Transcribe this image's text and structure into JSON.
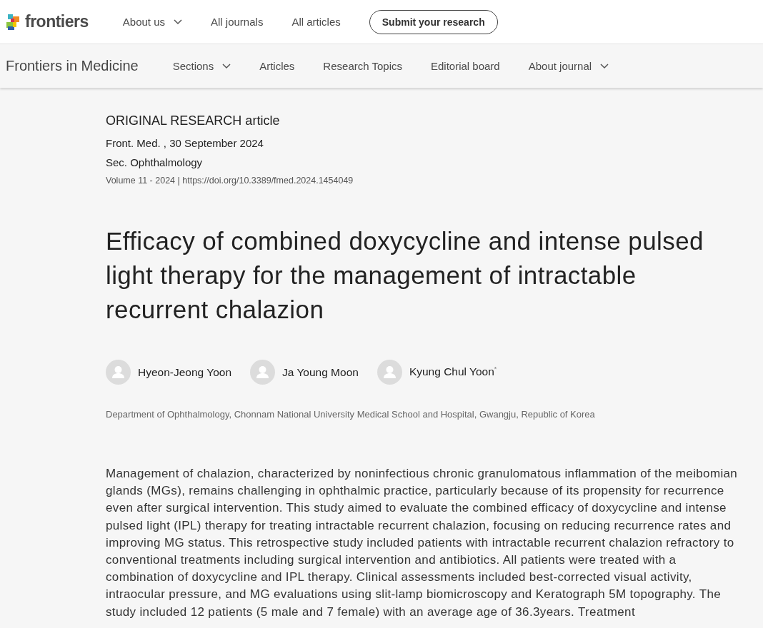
{
  "top_nav": {
    "logo": "frontiers",
    "items": [
      {
        "label": "About us",
        "dropdown": true
      },
      {
        "label": "All journals",
        "dropdown": false
      },
      {
        "label": "All articles",
        "dropdown": false
      }
    ],
    "button": "Submit your research"
  },
  "journal_nav": {
    "title": "Frontiers in Medicine",
    "items": [
      {
        "label": "Sections",
        "dropdown": true
      },
      {
        "label": "Articles",
        "dropdown": false
      },
      {
        "label": "Research Topics",
        "dropdown": false
      },
      {
        "label": "Editorial board",
        "dropdown": false
      },
      {
        "label": "About journal",
        "dropdown": true
      }
    ]
  },
  "article": {
    "type": "ORIGINAL RESEARCH article",
    "date": "Front. Med. , 30 September 2024",
    "section": "Sec. Ophthalmology",
    "volume": "Volume 11 - 2024 | https://doi.org/10.3389/fmed.2024.1454049",
    "title": "Efficacy of combined doxycycline and intense pulsed light therapy for the management of intractable recurrent chalazion",
    "authors": [
      {
        "name": "Hyeon-Jeong Yoon"
      },
      {
        "name": "Ja Young Moon"
      },
      {
        "name": "Kyung Chul Yoon",
        "mark": "*"
      }
    ],
    "affiliation": "Department of Ophthalmology, Chonnam National University Medical School and Hospital, Gwangju, Republic of Korea",
    "abstract": "Management of chalazion, characterized by noninfectious chronic granulomatous inflammation of the meibomian glands (MGs), remains challenging in ophthalmic practice, particularly because of its propensity for recurrence even after surgical intervention. This study aimed to evaluate the combined efficacy of doxycycline and intense pulsed light (IPL) therapy for treating intractable recurrent chalazion, focusing on reducing recurrence rates and improving MG status. This retrospective study included patients with intractable recurrent chalazion refractory to conventional treatments including surgical intervention and antibiotics. All patients were treated with a combination of doxycycline and IPL therapy. Clinical assessments included best-corrected visual activity, intraocular pressure, and MG evaluations using slit-lamp biomicroscopy and Keratograph 5M topography. The study included 12 patients (5 male and 7 female) with an average age of 36.3years. Treatment"
  }
}
